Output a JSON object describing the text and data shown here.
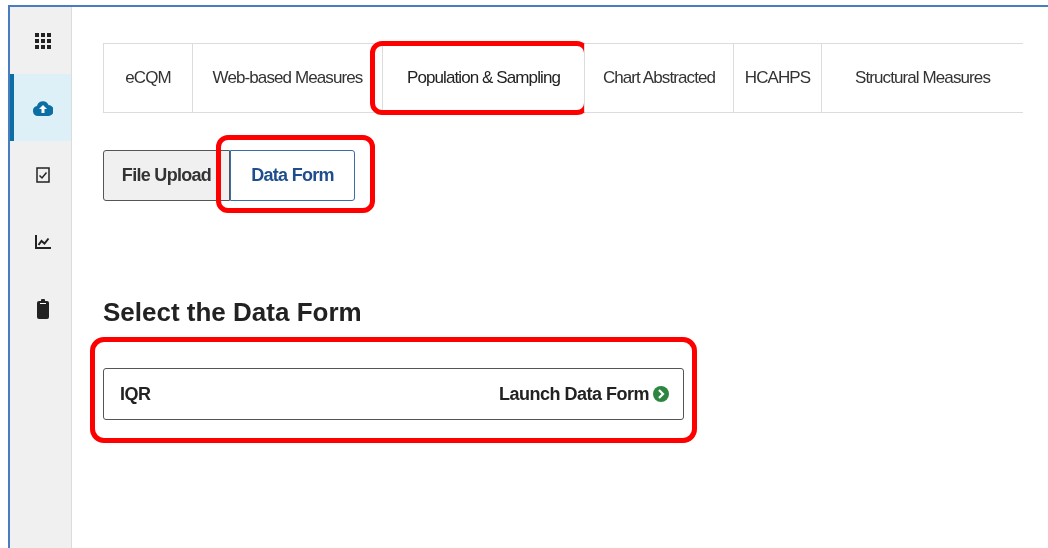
{
  "sidebar": {
    "items": [
      {
        "kind": "grid",
        "selected": false
      },
      {
        "kind": "upload",
        "selected": true
      },
      {
        "kind": "checklist",
        "selected": false
      },
      {
        "kind": "chart",
        "selected": false
      },
      {
        "kind": "clipboard",
        "selected": false
      }
    ]
  },
  "tabs": [
    {
      "label": "eCQM",
      "selected": false,
      "highlighted": false
    },
    {
      "label": "Web-based Measures",
      "selected": false,
      "highlighted": false
    },
    {
      "label": "Population & Sampling",
      "selected": true,
      "highlighted": true
    },
    {
      "label": "Chart Abstracted",
      "selected": false,
      "highlighted": false
    },
    {
      "label": "HCAHPS",
      "selected": false,
      "highlighted": false
    },
    {
      "label": "Structural Measures",
      "selected": false,
      "highlighted": false
    }
  ],
  "subtabs": [
    {
      "label": "File Upload",
      "selected": false,
      "highlighted": false
    },
    {
      "label": "Data Form",
      "selected": true,
      "highlighted": true
    }
  ],
  "heading": "Select the Data Form",
  "forms": [
    {
      "name": "IQR",
      "action": "Launch Data Form",
      "highlighted": true
    }
  ]
}
